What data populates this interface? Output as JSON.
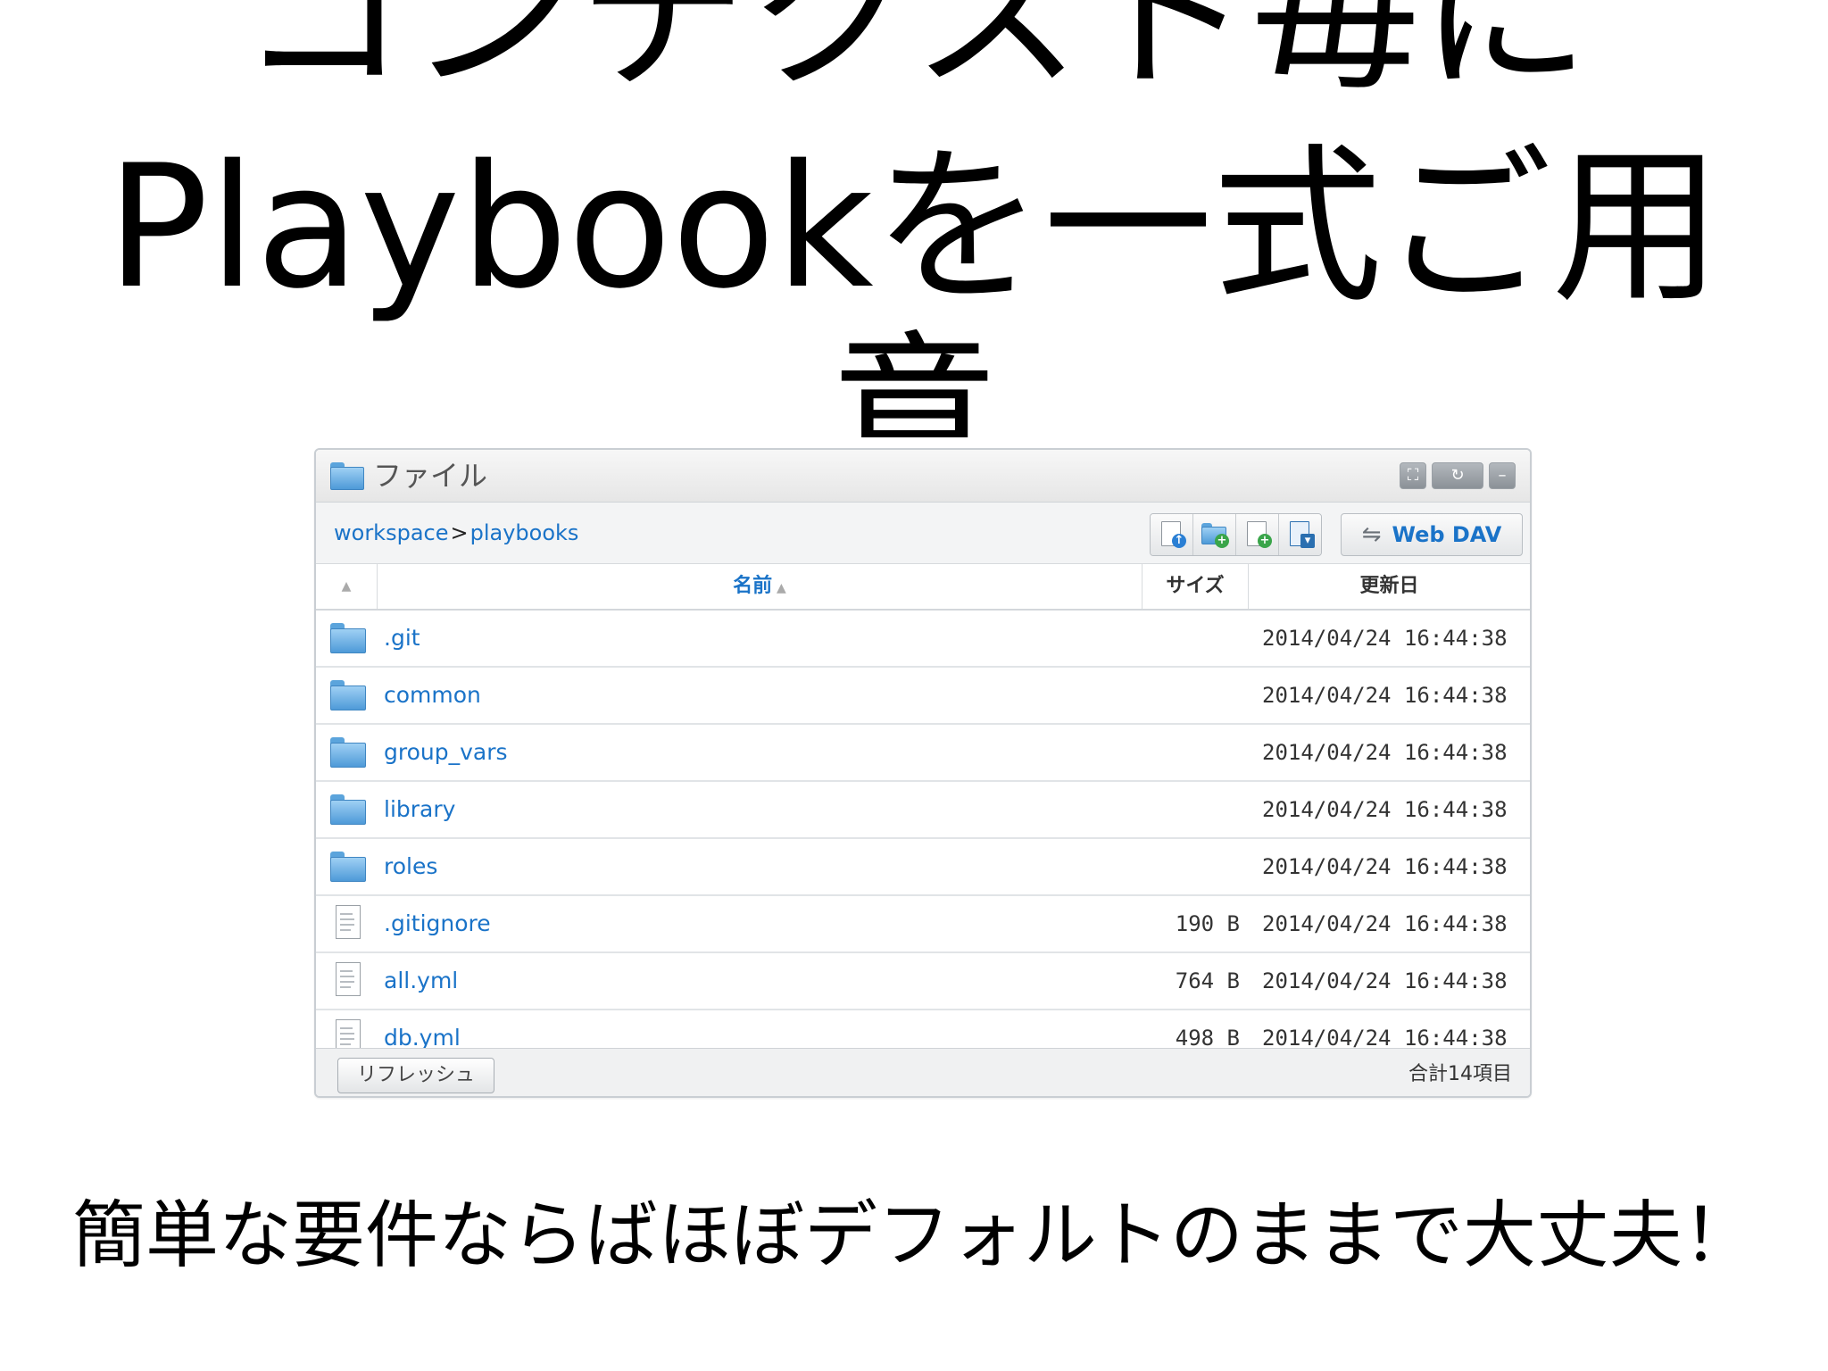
{
  "slide": {
    "title_lines": [
      "コンテクスト毎に",
      "Playbookを一式ご用",
      "意"
    ],
    "footer_text": "簡単な要件ならばほぼデフォルトのままで大丈夫！"
  },
  "panel": {
    "title": "ファイル",
    "title_icon": "folder-icon",
    "window_buttons": [
      "maximize-icon",
      "refresh-icon",
      "minimize-icon"
    ],
    "breadcrumb": [
      "workspace",
      "playbooks"
    ],
    "breadcrumb_separator": ">",
    "tools": [
      "upload-icon",
      "new-folder-icon",
      "new-file-icon",
      "bookmark-icon"
    ],
    "webdav_label": "Web DAV",
    "columns": {
      "name": "名前",
      "size": "サイズ",
      "date": "更新日"
    },
    "rows": [
      {
        "type": "folder",
        "name": ".git",
        "size": "",
        "date": "2014/04/24 16:44:38"
      },
      {
        "type": "folder",
        "name": "common",
        "size": "",
        "date": "2014/04/24 16:44:38"
      },
      {
        "type": "folder",
        "name": "group_vars",
        "size": "",
        "date": "2014/04/24 16:44:38"
      },
      {
        "type": "folder",
        "name": "library",
        "size": "",
        "date": "2014/04/24 16:44:38"
      },
      {
        "type": "folder",
        "name": "roles",
        "size": "",
        "date": "2014/04/24 16:44:38"
      },
      {
        "type": "file",
        "name": ".gitignore",
        "size": "190 B",
        "date": "2014/04/24 16:44:38"
      },
      {
        "type": "file",
        "name": "all.yml",
        "size": "764 B",
        "date": "2014/04/24 16:44:38"
      },
      {
        "type": "file",
        "name": "db.yml",
        "size": "498 B",
        "date": "2014/04/24 16:44:38"
      }
    ],
    "refresh_label": "リフレッシュ",
    "total_label": "合計14項目"
  },
  "colors": {
    "link_blue": "#1a73c8",
    "folder_blue": "#6fb3e8",
    "border_gray": "#c9ced3"
  }
}
